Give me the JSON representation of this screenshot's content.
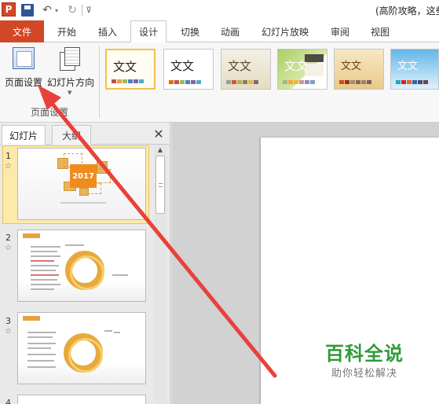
{
  "app": {
    "logo_letter": "P",
    "doc_title": "(高阶攻略，这些"
  },
  "quick_access": {
    "undo_glyph": "↶",
    "redo_glyph": "↻",
    "dropdown_glyph": "▾",
    "customize_glyph": "⊽"
  },
  "tabs": {
    "file": "文件",
    "home": "开始",
    "insert": "插入",
    "design": "设计",
    "transitions": "切换",
    "animations": "动画",
    "slideshow": "幻灯片放映",
    "review": "审阅",
    "view": "视图"
  },
  "ribbon": {
    "page_setup_label": "页面设置",
    "orientation_label": "幻灯片方向",
    "group_label": "页面设置",
    "theme_text": "文文",
    "theme_text_alt": "文文",
    "theme_colors": [
      "#c0504d",
      "#f79646",
      "#9bbb59",
      "#4f81bd",
      "#8064a2",
      "#4bacc6"
    ]
  },
  "left_pane": {
    "tab_slides": "幻灯片",
    "tab_outline": "大纲",
    "close_glyph": "✕",
    "star_glyph": "☆",
    "slide_numbers": [
      "1",
      "2",
      "3",
      "4"
    ],
    "slide1_year": "2017"
  },
  "watermark": {
    "title": "百科全说",
    "subtitle": "助你轻松解决"
  },
  "colors": {
    "accent_orange": "#d24726",
    "arrow_red": "#e8413c",
    "watermark_green": "#2f9b3a"
  }
}
